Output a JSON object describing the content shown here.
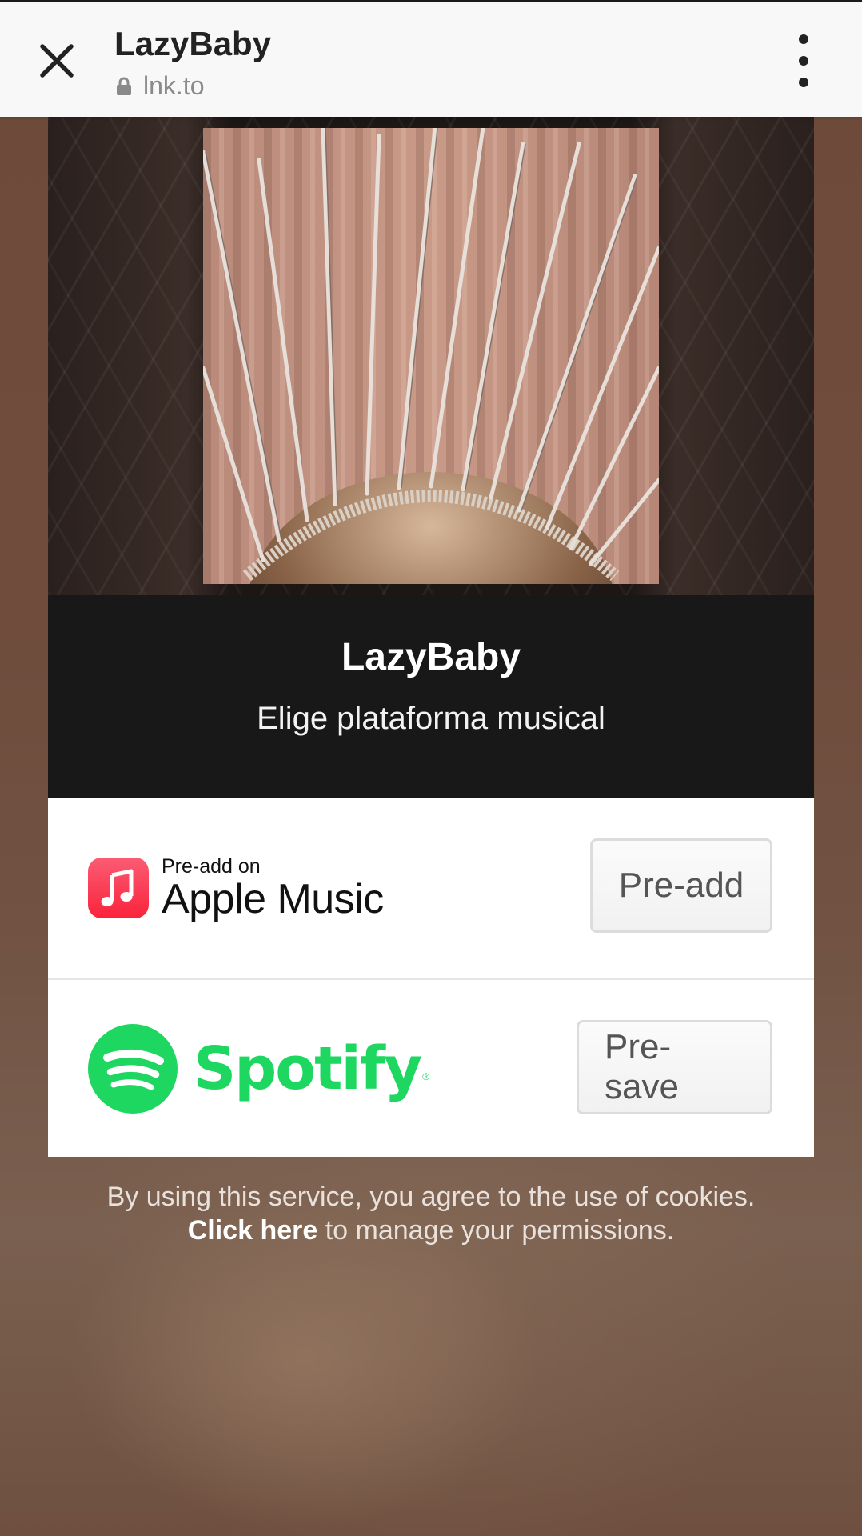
{
  "browser": {
    "title": "LazyBaby",
    "url": "lnk.to",
    "close_icon": "close-icon",
    "menu_icon": "more-vert-icon",
    "lock_icon": "lock-icon"
  },
  "release": {
    "title": "LazyBaby",
    "subtitle": "Elige plataforma musical"
  },
  "services": [
    {
      "name": "Apple Music",
      "logo_small": "Pre-add on",
      "logo_big": "Apple Music",
      "icon": "apple-music-icon",
      "button": "Pre-add",
      "color": "#fa2d48"
    },
    {
      "name": "Spotify",
      "logo_word": "Spotify",
      "registered_mark": "®",
      "icon": "spotify-icon",
      "button": "Pre-save",
      "color": "#1ed760"
    }
  ],
  "cookie": {
    "line1": "By using this service, you agree to the use of cookies.",
    "link": "Click here",
    "line2_rest": " to manage your permissions."
  }
}
